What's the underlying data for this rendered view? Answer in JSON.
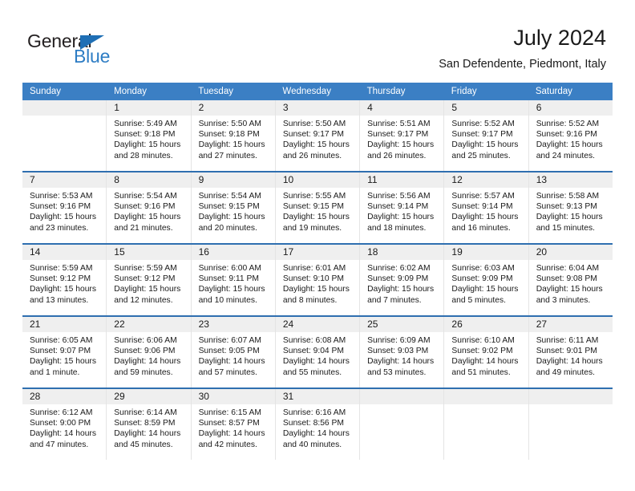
{
  "brand": {
    "name_dark": "General",
    "name_blue": "Blue",
    "accent_color": "#2e7dc4",
    "triangle_color": "#1f6fb5"
  },
  "header": {
    "title": "July 2024",
    "subtitle": "San Defendente, Piedmont, Italy"
  },
  "calendar": {
    "header_color": "#3b7fc4",
    "week_divider_color": "#2f6fb0",
    "daynum_band_color": "#efefef",
    "weekdays": [
      "Sunday",
      "Monday",
      "Tuesday",
      "Wednesday",
      "Thursday",
      "Friday",
      "Saturday"
    ],
    "weeks": [
      [
        {
          "day": "",
          "sunrise": "",
          "sunset": "",
          "daylight": "",
          "daylight2": ""
        },
        {
          "day": "1",
          "sunrise": "Sunrise: 5:49 AM",
          "sunset": "Sunset: 9:18 PM",
          "daylight": "Daylight: 15 hours",
          "daylight2": "and 28 minutes."
        },
        {
          "day": "2",
          "sunrise": "Sunrise: 5:50 AM",
          "sunset": "Sunset: 9:18 PM",
          "daylight": "Daylight: 15 hours",
          "daylight2": "and 27 minutes."
        },
        {
          "day": "3",
          "sunrise": "Sunrise: 5:50 AM",
          "sunset": "Sunset: 9:17 PM",
          "daylight": "Daylight: 15 hours",
          "daylight2": "and 26 minutes."
        },
        {
          "day": "4",
          "sunrise": "Sunrise: 5:51 AM",
          "sunset": "Sunset: 9:17 PM",
          "daylight": "Daylight: 15 hours",
          "daylight2": "and 26 minutes."
        },
        {
          "day": "5",
          "sunrise": "Sunrise: 5:52 AM",
          "sunset": "Sunset: 9:17 PM",
          "daylight": "Daylight: 15 hours",
          "daylight2": "and 25 minutes."
        },
        {
          "day": "6",
          "sunrise": "Sunrise: 5:52 AM",
          "sunset": "Sunset: 9:16 PM",
          "daylight": "Daylight: 15 hours",
          "daylight2": "and 24 minutes."
        }
      ],
      [
        {
          "day": "7",
          "sunrise": "Sunrise: 5:53 AM",
          "sunset": "Sunset: 9:16 PM",
          "daylight": "Daylight: 15 hours",
          "daylight2": "and 23 minutes."
        },
        {
          "day": "8",
          "sunrise": "Sunrise: 5:54 AM",
          "sunset": "Sunset: 9:16 PM",
          "daylight": "Daylight: 15 hours",
          "daylight2": "and 21 minutes."
        },
        {
          "day": "9",
          "sunrise": "Sunrise: 5:54 AM",
          "sunset": "Sunset: 9:15 PM",
          "daylight": "Daylight: 15 hours",
          "daylight2": "and 20 minutes."
        },
        {
          "day": "10",
          "sunrise": "Sunrise: 5:55 AM",
          "sunset": "Sunset: 9:15 PM",
          "daylight": "Daylight: 15 hours",
          "daylight2": "and 19 minutes."
        },
        {
          "day": "11",
          "sunrise": "Sunrise: 5:56 AM",
          "sunset": "Sunset: 9:14 PM",
          "daylight": "Daylight: 15 hours",
          "daylight2": "and 18 minutes."
        },
        {
          "day": "12",
          "sunrise": "Sunrise: 5:57 AM",
          "sunset": "Sunset: 9:14 PM",
          "daylight": "Daylight: 15 hours",
          "daylight2": "and 16 minutes."
        },
        {
          "day": "13",
          "sunrise": "Sunrise: 5:58 AM",
          "sunset": "Sunset: 9:13 PM",
          "daylight": "Daylight: 15 hours",
          "daylight2": "and 15 minutes."
        }
      ],
      [
        {
          "day": "14",
          "sunrise": "Sunrise: 5:59 AM",
          "sunset": "Sunset: 9:12 PM",
          "daylight": "Daylight: 15 hours",
          "daylight2": "and 13 minutes."
        },
        {
          "day": "15",
          "sunrise": "Sunrise: 5:59 AM",
          "sunset": "Sunset: 9:12 PM",
          "daylight": "Daylight: 15 hours",
          "daylight2": "and 12 minutes."
        },
        {
          "day": "16",
          "sunrise": "Sunrise: 6:00 AM",
          "sunset": "Sunset: 9:11 PM",
          "daylight": "Daylight: 15 hours",
          "daylight2": "and 10 minutes."
        },
        {
          "day": "17",
          "sunrise": "Sunrise: 6:01 AM",
          "sunset": "Sunset: 9:10 PM",
          "daylight": "Daylight: 15 hours",
          "daylight2": "and 8 minutes."
        },
        {
          "day": "18",
          "sunrise": "Sunrise: 6:02 AM",
          "sunset": "Sunset: 9:09 PM",
          "daylight": "Daylight: 15 hours",
          "daylight2": "and 7 minutes."
        },
        {
          "day": "19",
          "sunrise": "Sunrise: 6:03 AM",
          "sunset": "Sunset: 9:09 PM",
          "daylight": "Daylight: 15 hours",
          "daylight2": "and 5 minutes."
        },
        {
          "day": "20",
          "sunrise": "Sunrise: 6:04 AM",
          "sunset": "Sunset: 9:08 PM",
          "daylight": "Daylight: 15 hours",
          "daylight2": "and 3 minutes."
        }
      ],
      [
        {
          "day": "21",
          "sunrise": "Sunrise: 6:05 AM",
          "sunset": "Sunset: 9:07 PM",
          "daylight": "Daylight: 15 hours",
          "daylight2": "and 1 minute."
        },
        {
          "day": "22",
          "sunrise": "Sunrise: 6:06 AM",
          "sunset": "Sunset: 9:06 PM",
          "daylight": "Daylight: 14 hours",
          "daylight2": "and 59 minutes."
        },
        {
          "day": "23",
          "sunrise": "Sunrise: 6:07 AM",
          "sunset": "Sunset: 9:05 PM",
          "daylight": "Daylight: 14 hours",
          "daylight2": "and 57 minutes."
        },
        {
          "day": "24",
          "sunrise": "Sunrise: 6:08 AM",
          "sunset": "Sunset: 9:04 PM",
          "daylight": "Daylight: 14 hours",
          "daylight2": "and 55 minutes."
        },
        {
          "day": "25",
          "sunrise": "Sunrise: 6:09 AM",
          "sunset": "Sunset: 9:03 PM",
          "daylight": "Daylight: 14 hours",
          "daylight2": "and 53 minutes."
        },
        {
          "day": "26",
          "sunrise": "Sunrise: 6:10 AM",
          "sunset": "Sunset: 9:02 PM",
          "daylight": "Daylight: 14 hours",
          "daylight2": "and 51 minutes."
        },
        {
          "day": "27",
          "sunrise": "Sunrise: 6:11 AM",
          "sunset": "Sunset: 9:01 PM",
          "daylight": "Daylight: 14 hours",
          "daylight2": "and 49 minutes."
        }
      ],
      [
        {
          "day": "28",
          "sunrise": "Sunrise: 6:12 AM",
          "sunset": "Sunset: 9:00 PM",
          "daylight": "Daylight: 14 hours",
          "daylight2": "and 47 minutes."
        },
        {
          "day": "29",
          "sunrise": "Sunrise: 6:14 AM",
          "sunset": "Sunset: 8:59 PM",
          "daylight": "Daylight: 14 hours",
          "daylight2": "and 45 minutes."
        },
        {
          "day": "30",
          "sunrise": "Sunrise: 6:15 AM",
          "sunset": "Sunset: 8:57 PM",
          "daylight": "Daylight: 14 hours",
          "daylight2": "and 42 minutes."
        },
        {
          "day": "31",
          "sunrise": "Sunrise: 6:16 AM",
          "sunset": "Sunset: 8:56 PM",
          "daylight": "Daylight: 14 hours",
          "daylight2": "and 40 minutes."
        },
        {
          "day": "",
          "sunrise": "",
          "sunset": "",
          "daylight": "",
          "daylight2": ""
        },
        {
          "day": "",
          "sunrise": "",
          "sunset": "",
          "daylight": "",
          "daylight2": ""
        },
        {
          "day": "",
          "sunrise": "",
          "sunset": "",
          "daylight": "",
          "daylight2": ""
        }
      ]
    ]
  }
}
